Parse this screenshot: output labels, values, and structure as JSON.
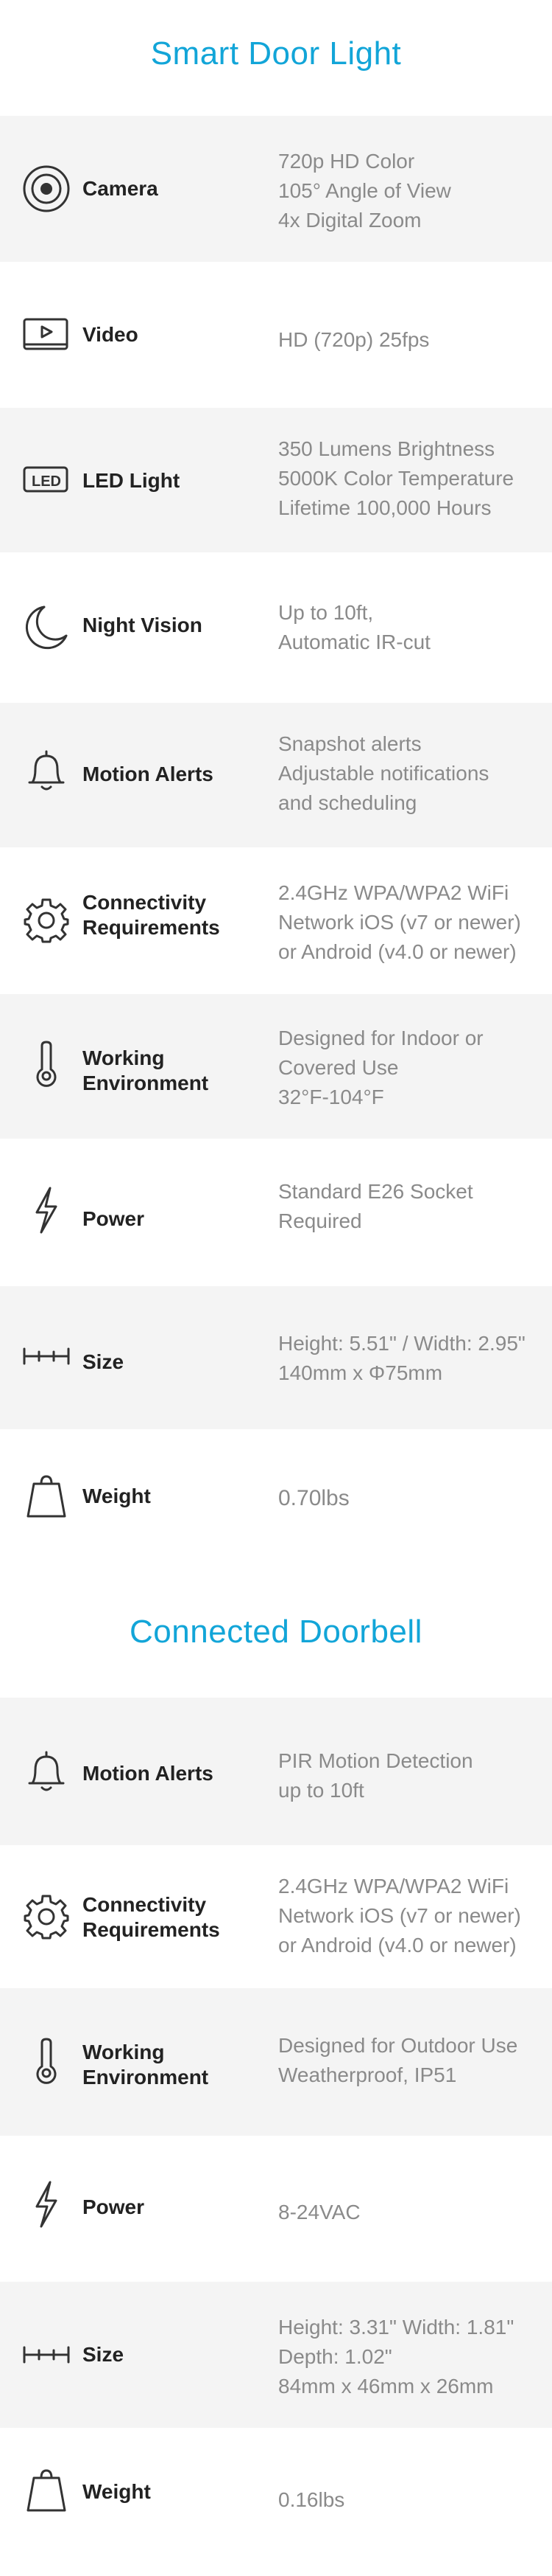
{
  "sections": [
    {
      "title": "Smart Door Light",
      "rows": [
        {
          "icon": "camera-icon",
          "label": [
            "Camera"
          ],
          "value": [
            "720p HD Color",
            "105° Angle of View",
            "4x Digital Zoom"
          ]
        },
        {
          "icon": "video-icon",
          "label": [
            "Video"
          ],
          "value": [
            "HD (720p) 25fps"
          ]
        },
        {
          "icon": "led-icon",
          "icon_text": "LED",
          "label": [
            "LED Light"
          ],
          "value": [
            "350 Lumens Brightness",
            "5000K Color Temperature",
            "Lifetime 100,000 Hours"
          ]
        },
        {
          "icon": "moon-icon",
          "label": [
            "Night Vision"
          ],
          "value": [
            "Up to 10ft,",
            "Automatic IR-cut"
          ]
        },
        {
          "icon": "bell-icon",
          "label": [
            "Motion Alerts"
          ],
          "value": [
            "Snapshot alerts",
            "Adjustable notifications",
            "and scheduling"
          ]
        },
        {
          "icon": "gear-icon",
          "label": [
            "Connectivity",
            "Requirements"
          ],
          "value": [
            "2.4GHz WPA/WPA2 WiFi",
            "Network iOS (v7 or newer)",
            "or Android  (v4.0 or newer)"
          ]
        },
        {
          "icon": "thermometer-icon",
          "label": [
            "Working",
            "Environment"
          ],
          "value": [
            "Designed for Indoor or",
            "Covered Use",
            "32°F-104°F"
          ]
        },
        {
          "icon": "lightning-icon",
          "label": [
            "Power"
          ],
          "value": [
            "Standard E26 Socket",
            "Required"
          ]
        },
        {
          "icon": "ruler-icon",
          "label": [
            "Size"
          ],
          "value": [
            "Height: 5.51\" / Width: 2.95\"",
            "140mm x Φ75mm"
          ]
        },
        {
          "icon": "weight-icon",
          "label": [
            "Weight"
          ],
          "value": [
            "0.70lbs"
          ]
        }
      ]
    },
    {
      "title": "Connected Doorbell",
      "rows": [
        {
          "icon": "bell-icon",
          "label": [
            "Motion Alerts"
          ],
          "value": [
            "PIR Motion Detection",
            "up to 10ft"
          ]
        },
        {
          "icon": "gear-icon",
          "label": [
            "Connectivity",
            "Requirements"
          ],
          "value": [
            "2.4GHz WPA/WPA2 WiFi",
            "Network iOS (v7 or newer)",
            "or Android (v4.0 or newer)"
          ]
        },
        {
          "icon": "thermometer-icon",
          "label": [
            "Working",
            "Environment"
          ],
          "value": [
            "Designed for Outdoor Use",
            "Weatherproof, IP51"
          ]
        },
        {
          "icon": "lightning-icon",
          "label": [
            "Power"
          ],
          "value": [
            "8-24VAC"
          ]
        },
        {
          "icon": "ruler-icon",
          "label": [
            "Size"
          ],
          "value": [
            "Height: 3.31\"  Width: 1.81\"",
            "Depth: 1.02\"",
            "84mm x 46mm x 26mm"
          ]
        },
        {
          "icon": "weight-icon",
          "label": [
            "Weight"
          ],
          "value": [
            "0.16lbs"
          ]
        }
      ]
    }
  ],
  "colors": {
    "title": "#12a5d8",
    "shaded_row": "#f4f4f4",
    "label": "#222222",
    "value": "#8a8a8a"
  }
}
